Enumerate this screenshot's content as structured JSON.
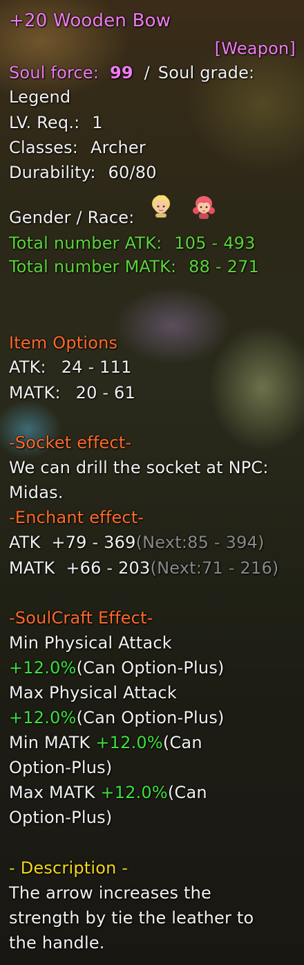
{
  "item": {
    "name": "+20 Wooden Bow",
    "type": "[Weapon]",
    "soul_force_label": "Soul force:",
    "soul_force_value": "99",
    "soul_grade_sep": "/",
    "soul_grade_label": "Soul grade:",
    "soul_grade_value": "Legend",
    "lv_label": "LV. Req.:",
    "lv_value": "1",
    "classes_label": "Classes:",
    "classes_value": "Archer",
    "durability_label": "Durability:",
    "durability_value": "60/80",
    "gender_race_label": "Gender / Race:",
    "total_atk_label": "Total number ATK:",
    "total_atk_value": "105 - 493",
    "total_matk_label": "Total number MATK:",
    "total_matk_value": "88 - 271"
  },
  "options": {
    "header": "Item Options",
    "atk_label": "ATK:",
    "atk_value": "24 - 111",
    "matk_label": "MATK:",
    "matk_value": "20 - 61"
  },
  "socket": {
    "header": "-Socket effect-",
    "line1": "We can drill the socket at NPC:",
    "line2": "Midas."
  },
  "enchant": {
    "header": "-Enchant effect-",
    "atk_label": "ATK",
    "atk_value": "+79 - 369",
    "atk_next": "(Next:85 - 394)",
    "matk_label": "MATK",
    "matk_value": "+66 - 203",
    "matk_next": "(Next:71 - 216)"
  },
  "soulcraft": {
    "header": "-SoulCraft Effect-",
    "min_phys_label": "Min Physical Attack",
    "min_phys_value": "+12.0%",
    "min_phys_note": "(Can Option-Plus)",
    "max_phys_label": "Max Physical Attack",
    "max_phys_value": "+12.0%",
    "max_phys_note": "(Can Option-Plus)",
    "min_matk_label": "Min MATK",
    "min_matk_value": "+12.0%",
    "min_matk_note": "(Can",
    "min_matk_note2": "Option-Plus)",
    "max_matk_label": "Max MATK",
    "max_matk_value": "+12.0%",
    "max_matk_note": "(Can",
    "max_matk_note2": "Option-Plus)"
  },
  "description": {
    "header": "- Description -",
    "line1": "The arrow increases the",
    "line2": "strength by tie the leather to",
    "line3": "the handle."
  },
  "icons": [
    "male-character-icon",
    "female-character-icon"
  ],
  "colors": {
    "title": "#f07cf0",
    "stat_green": "#5cd43a",
    "section_orange": "#ff6a2a",
    "description_yellow": "#f2d81c",
    "next_grey": "#8a8a8a"
  }
}
